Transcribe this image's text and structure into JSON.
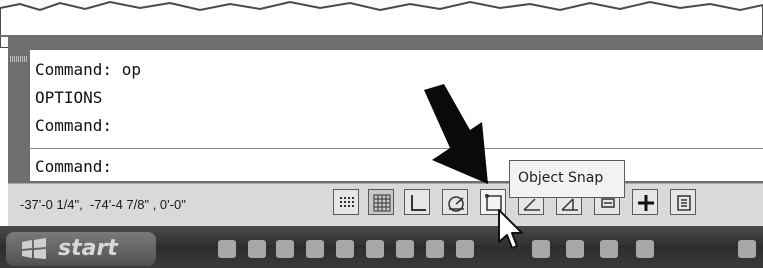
{
  "command_history": {
    "lines": [
      "Command: op",
      "OPTIONS",
      "Command:"
    ]
  },
  "command_line": {
    "prompt": "Command:"
  },
  "status_bar": {
    "coordinates": "-37'-0 1/4\",  -74'-4 7/8\" , 0'-0\"",
    "buttons": [
      {
        "name": "snap-mode-button",
        "icon": "snap-dots-icon"
      },
      {
        "name": "grid-display-button",
        "icon": "grid-icon"
      },
      {
        "name": "ortho-mode-button",
        "icon": "ortho-icon"
      },
      {
        "name": "polar-tracking-button",
        "icon": "polar-icon"
      },
      {
        "name": "object-snap-button",
        "icon": "object-snap-icon"
      },
      {
        "name": "3d-object-snap-button",
        "icon": "3d-snap-icon"
      },
      {
        "name": "dynamic-ucs-button",
        "icon": "dynamic-ucs-icon"
      },
      {
        "name": "dynamic-input-button",
        "icon": "dynamic-input-icon"
      },
      {
        "name": "lineweight-button",
        "icon": "plus-icon"
      },
      {
        "name": "quick-properties-button",
        "icon": "properties-icon"
      }
    ]
  },
  "tooltip": {
    "text": "Object Snap"
  },
  "taskbar": {
    "start_label": "start"
  },
  "colors": {
    "frame": "#6e6e6e",
    "status_bar": "#d9d9d9",
    "taskbar": "#3a3a3a"
  }
}
